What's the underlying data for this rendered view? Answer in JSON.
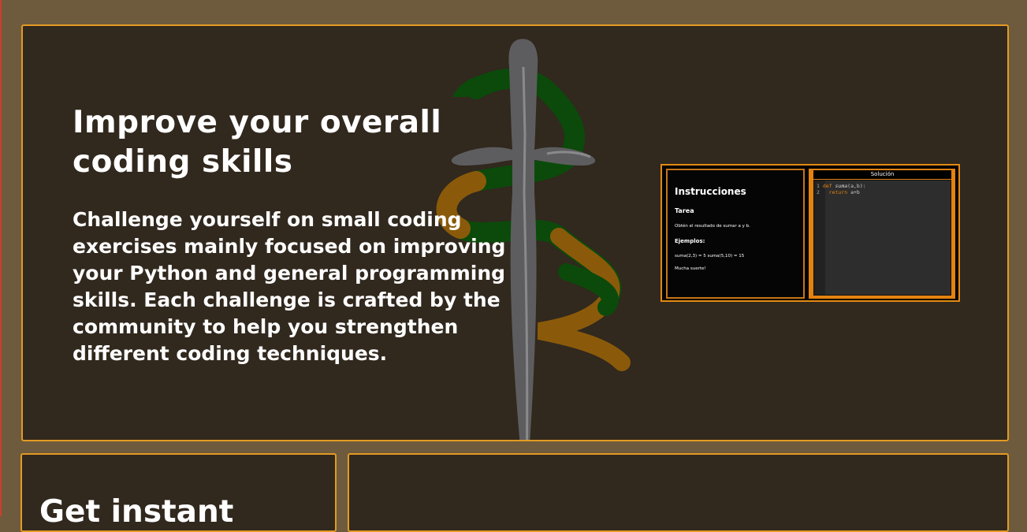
{
  "hero": {
    "title": "Improve your overall coding skills",
    "description": "Challenge yourself on small coding exercises mainly focused on improving your Python and general programming skills. Each challenge is crafted by the community to help you strengthen different coding techniques."
  },
  "preview": {
    "instructions_title": "Instrucciones",
    "task_label": "Tarea",
    "task_text": "Obtén el resultado de sumar a y b.",
    "examples_label": "Ejemplos:",
    "examples_text": "suma(2,3) = 5 suma(5,10) = 15",
    "luck_text": "Mucha suerte!",
    "solution_title": "Solución",
    "code": {
      "line1_num": "1",
      "line1_kw": "def",
      "line1_fn": "suma",
      "line1_rest": "(a,b):",
      "line2_num": "2",
      "line2_kw": "return",
      "line2_rest": "a+b"
    }
  },
  "card_left": {
    "title": "Get instant"
  },
  "colors": {
    "background": "#6e5b3e",
    "panel": "#31281e",
    "accent": "#e39a22",
    "snake_green": "#0b4a0b",
    "snake_orange": "#8a5a0a"
  },
  "icons": {
    "emblem": "sword-snake-emblem-icon"
  }
}
